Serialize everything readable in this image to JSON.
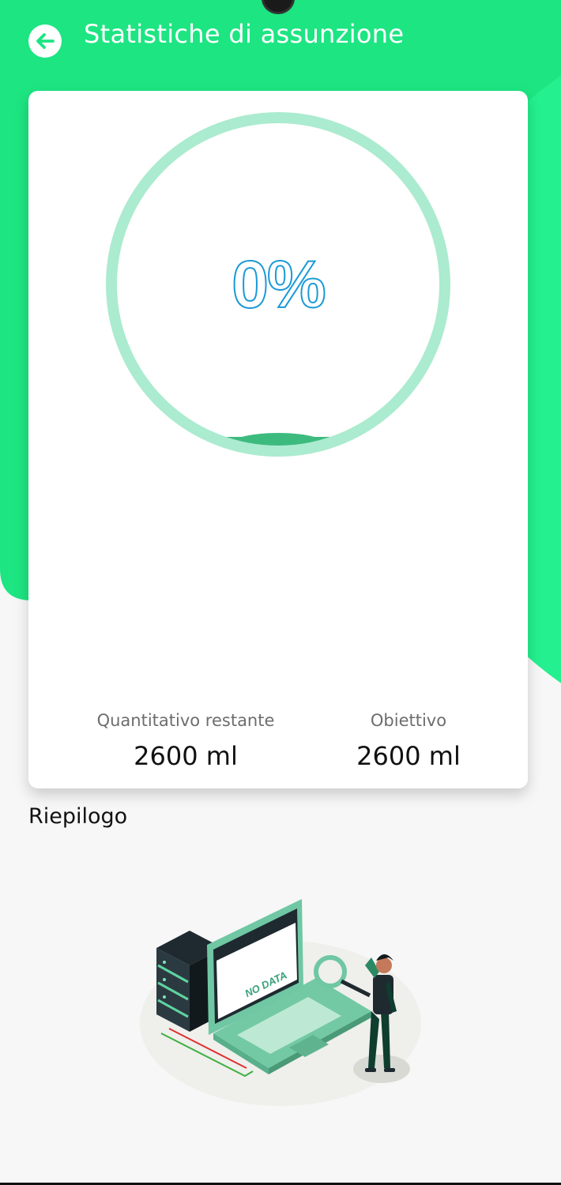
{
  "header": {
    "title": "Statistiche di assunzione",
    "back_icon": "arrow-left-icon"
  },
  "progress": {
    "percent_text": "0%",
    "fraction": 0,
    "ring_color": "#abebcf",
    "fill_color": "#3dbb7f",
    "text_color": "#1a9ad6"
  },
  "stats": {
    "remaining_label": "Quantitativo restante",
    "remaining_value": "2600 ml",
    "goal_label": "Obiettivo",
    "goal_value": "2600 ml"
  },
  "summary": {
    "title": "Riepilogo",
    "empty_image_text": "NO DATA"
  },
  "colors": {
    "brand_green": "#1de582",
    "brand_green_light": "#24f08f",
    "background": "#f7f7f7"
  }
}
